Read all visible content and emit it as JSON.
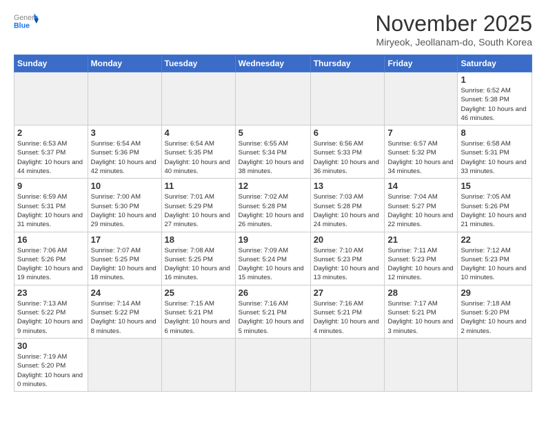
{
  "header": {
    "logo_general": "General",
    "logo_blue": "Blue",
    "month_title": "November 2025",
    "location": "Miryeok, Jeollanam-do, South Korea"
  },
  "weekdays": [
    "Sunday",
    "Monday",
    "Tuesday",
    "Wednesday",
    "Thursday",
    "Friday",
    "Saturday"
  ],
  "weeks": [
    [
      {
        "day": "",
        "info": ""
      },
      {
        "day": "",
        "info": ""
      },
      {
        "day": "",
        "info": ""
      },
      {
        "day": "",
        "info": ""
      },
      {
        "day": "",
        "info": ""
      },
      {
        "day": "",
        "info": ""
      },
      {
        "day": "1",
        "info": "Sunrise: 6:52 AM\nSunset: 5:38 PM\nDaylight: 10 hours and 46 minutes."
      }
    ],
    [
      {
        "day": "2",
        "info": "Sunrise: 6:53 AM\nSunset: 5:37 PM\nDaylight: 10 hours and 44 minutes."
      },
      {
        "day": "3",
        "info": "Sunrise: 6:54 AM\nSunset: 5:36 PM\nDaylight: 10 hours and 42 minutes."
      },
      {
        "day": "4",
        "info": "Sunrise: 6:54 AM\nSunset: 5:35 PM\nDaylight: 10 hours and 40 minutes."
      },
      {
        "day": "5",
        "info": "Sunrise: 6:55 AM\nSunset: 5:34 PM\nDaylight: 10 hours and 38 minutes."
      },
      {
        "day": "6",
        "info": "Sunrise: 6:56 AM\nSunset: 5:33 PM\nDaylight: 10 hours and 36 minutes."
      },
      {
        "day": "7",
        "info": "Sunrise: 6:57 AM\nSunset: 5:32 PM\nDaylight: 10 hours and 34 minutes."
      },
      {
        "day": "8",
        "info": "Sunrise: 6:58 AM\nSunset: 5:31 PM\nDaylight: 10 hours and 33 minutes."
      }
    ],
    [
      {
        "day": "9",
        "info": "Sunrise: 6:59 AM\nSunset: 5:31 PM\nDaylight: 10 hours and 31 minutes."
      },
      {
        "day": "10",
        "info": "Sunrise: 7:00 AM\nSunset: 5:30 PM\nDaylight: 10 hours and 29 minutes."
      },
      {
        "day": "11",
        "info": "Sunrise: 7:01 AM\nSunset: 5:29 PM\nDaylight: 10 hours and 27 minutes."
      },
      {
        "day": "12",
        "info": "Sunrise: 7:02 AM\nSunset: 5:28 PM\nDaylight: 10 hours and 26 minutes."
      },
      {
        "day": "13",
        "info": "Sunrise: 7:03 AM\nSunset: 5:28 PM\nDaylight: 10 hours and 24 minutes."
      },
      {
        "day": "14",
        "info": "Sunrise: 7:04 AM\nSunset: 5:27 PM\nDaylight: 10 hours and 22 minutes."
      },
      {
        "day": "15",
        "info": "Sunrise: 7:05 AM\nSunset: 5:26 PM\nDaylight: 10 hours and 21 minutes."
      }
    ],
    [
      {
        "day": "16",
        "info": "Sunrise: 7:06 AM\nSunset: 5:26 PM\nDaylight: 10 hours and 19 minutes."
      },
      {
        "day": "17",
        "info": "Sunrise: 7:07 AM\nSunset: 5:25 PM\nDaylight: 10 hours and 18 minutes."
      },
      {
        "day": "18",
        "info": "Sunrise: 7:08 AM\nSunset: 5:25 PM\nDaylight: 10 hours and 16 minutes."
      },
      {
        "day": "19",
        "info": "Sunrise: 7:09 AM\nSunset: 5:24 PM\nDaylight: 10 hours and 15 minutes."
      },
      {
        "day": "20",
        "info": "Sunrise: 7:10 AM\nSunset: 5:23 PM\nDaylight: 10 hours and 13 minutes."
      },
      {
        "day": "21",
        "info": "Sunrise: 7:11 AM\nSunset: 5:23 PM\nDaylight: 10 hours and 12 minutes."
      },
      {
        "day": "22",
        "info": "Sunrise: 7:12 AM\nSunset: 5:23 PM\nDaylight: 10 hours and 10 minutes."
      }
    ],
    [
      {
        "day": "23",
        "info": "Sunrise: 7:13 AM\nSunset: 5:22 PM\nDaylight: 10 hours and 9 minutes."
      },
      {
        "day": "24",
        "info": "Sunrise: 7:14 AM\nSunset: 5:22 PM\nDaylight: 10 hours and 8 minutes."
      },
      {
        "day": "25",
        "info": "Sunrise: 7:15 AM\nSunset: 5:21 PM\nDaylight: 10 hours and 6 minutes."
      },
      {
        "day": "26",
        "info": "Sunrise: 7:16 AM\nSunset: 5:21 PM\nDaylight: 10 hours and 5 minutes."
      },
      {
        "day": "27",
        "info": "Sunrise: 7:16 AM\nSunset: 5:21 PM\nDaylight: 10 hours and 4 minutes."
      },
      {
        "day": "28",
        "info": "Sunrise: 7:17 AM\nSunset: 5:21 PM\nDaylight: 10 hours and 3 minutes."
      },
      {
        "day": "29",
        "info": "Sunrise: 7:18 AM\nSunset: 5:20 PM\nDaylight: 10 hours and 2 minutes."
      }
    ],
    [
      {
        "day": "30",
        "info": "Sunrise: 7:19 AM\nSunset: 5:20 PM\nDaylight: 10 hours and 0 minutes."
      },
      {
        "day": "",
        "info": ""
      },
      {
        "day": "",
        "info": ""
      },
      {
        "day": "",
        "info": ""
      },
      {
        "day": "",
        "info": ""
      },
      {
        "day": "",
        "info": ""
      },
      {
        "day": "",
        "info": ""
      }
    ]
  ]
}
